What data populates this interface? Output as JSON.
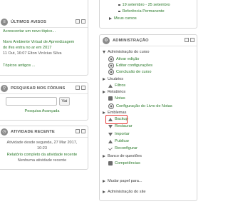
{
  "avisos": {
    "title": "Últimos Avisos",
    "add_link": "Acrescentar um novo tópico...",
    "post_title_1": "Novo Ambiente Virtual de Aprendizagem",
    "post_title_2": "do ifes entra no ar em 2017",
    "post_meta": "11 Out, 16:07  Elton Vinícius Silva",
    "older_link": "Tópicos antigos ..."
  },
  "forum_search": {
    "title": "Pesquisar nos fóruns",
    "input_value": "",
    "button_label": "Vai",
    "advanced_link": "Pesquisa Avançada"
  },
  "atividade": {
    "title": "Atividade recente",
    "since_line1": "Atividade desde segunda, 27 Mar 2017,",
    "since_line2": "10:23",
    "report_line1": "Relatório completo da atividade recente",
    "report_line2": "Nenhuma atividade recente"
  },
  "top_nav": {
    "item1": "19 setembro - 25 setembro",
    "item2": "Referência Permanente",
    "item3": "Meus cursos"
  },
  "admin": {
    "title": "Administração",
    "section_course": "Administração do curso",
    "items": [
      {
        "label": "Ativar edição",
        "icon": "pencil-icon"
      },
      {
        "label": "Editar configurações",
        "icon": "gear-icon"
      },
      {
        "label": "Conclusão de curso",
        "icon": "gear-icon"
      },
      {
        "label": "Usuários",
        "icon": "users-icon"
      },
      {
        "label": "Filtros",
        "icon": "filter-icon"
      },
      {
        "label": "Relatórios",
        "icon": "folder-icon"
      },
      {
        "label": "Notas",
        "icon": "grades-icon"
      },
      {
        "label": "Configuração do Livro de Notas",
        "icon": "gear-icon"
      },
      {
        "label": "Emblemas",
        "icon": "folder-icon"
      },
      {
        "label": "Backup",
        "icon": "backup-icon"
      },
      {
        "label": "Restaurar",
        "icon": "restore-icon"
      },
      {
        "label": "Importar",
        "icon": "import-icon"
      },
      {
        "label": "Publicar",
        "icon": "publish-icon"
      },
      {
        "label": "Reconfigurar",
        "icon": "reset-icon"
      },
      {
        "label": "Banco de questões",
        "icon": "folder-icon"
      },
      {
        "label": "Competências",
        "icon": "competency-icon"
      }
    ],
    "change_role": "Mudar papel para...",
    "site_admin": "Administração do site"
  },
  "colors": {
    "link": "#2b7a2b",
    "highlight": "#e53935",
    "folder": "#e3a92a"
  }
}
